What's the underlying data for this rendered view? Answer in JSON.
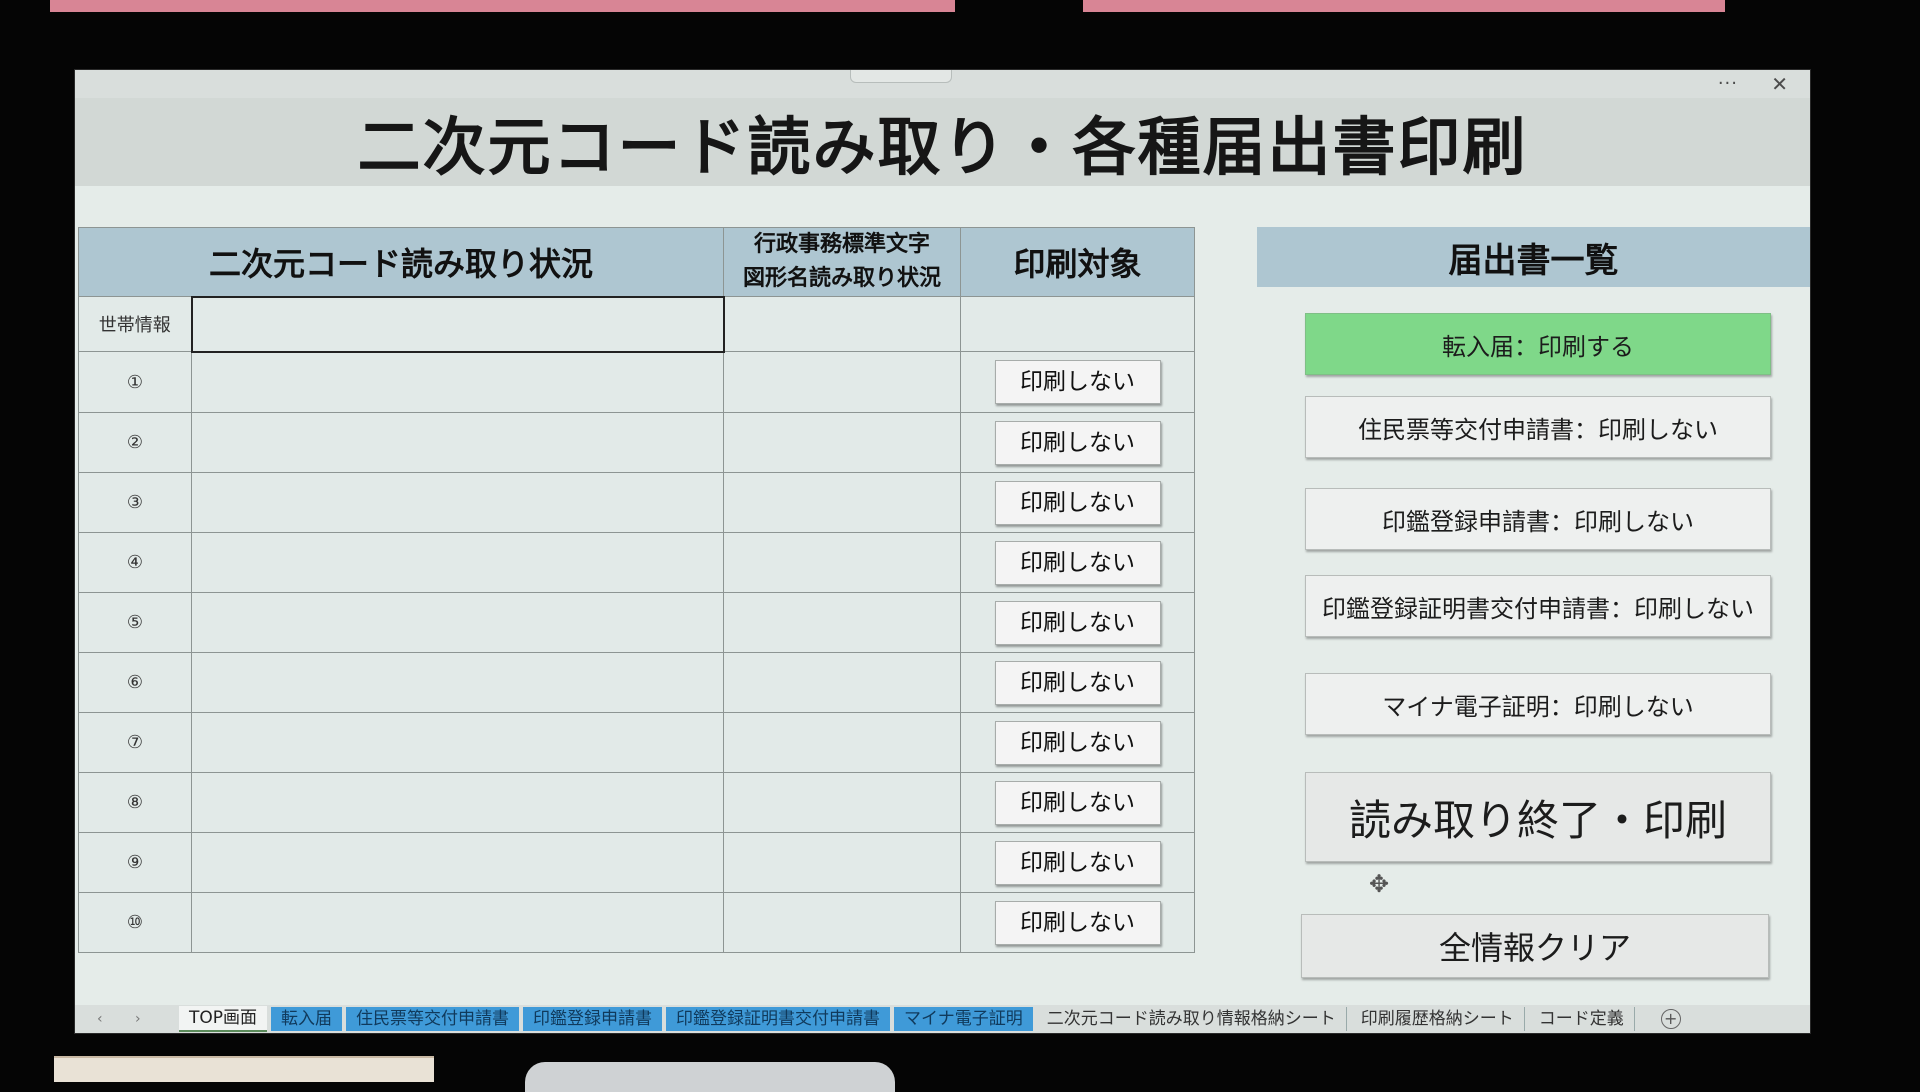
{
  "window": {
    "more_label": "···",
    "close_label": "✕"
  },
  "title": "二次元コード読み取り・各種届出書印刷",
  "table": {
    "headers": {
      "scan_status": "二次元コード読み取り状況",
      "std_char_line1": "行政事務標準文字",
      "std_char_line2": "図形名読み取り状況",
      "print_target": "印刷対象"
    },
    "household_label": "世帯情報",
    "rows": [
      {
        "label": "①",
        "button": "印刷しない"
      },
      {
        "label": "②",
        "button": "印刷しない"
      },
      {
        "label": "③",
        "button": "印刷しない"
      },
      {
        "label": "④",
        "button": "印刷しない"
      },
      {
        "label": "⑤",
        "button": "印刷しない"
      },
      {
        "label": "⑥",
        "button": "印刷しない"
      },
      {
        "label": "⑦",
        "button": "印刷しない"
      },
      {
        "label": "⑧",
        "button": "印刷しない"
      },
      {
        "label": "⑨",
        "button": "印刷しない"
      },
      {
        "label": "⑩",
        "button": "印刷しない"
      }
    ]
  },
  "forms_panel": {
    "header": "届出書一覧",
    "buttons": {
      "tennyu": "転入届：印刷する",
      "juminhyo": "住民票等交付申請書：印刷しない",
      "inkan": "印鑑登録申請書：印刷しない",
      "inkan_cert": "印鑑登録証明書交付申請書：印刷しない",
      "myna": "マイナ電子証明：印刷しない",
      "finish": "読み取り終了・印刷",
      "clear": "全情報クリア"
    },
    "active_color": "#7fd889"
  },
  "sheet_tabs": [
    "TOP画面",
    "転入届",
    "住民票等交付申請書",
    "印鑑登録申請書",
    "印鑑登録証明書交付申請書",
    "マイナ電子証明",
    "二次元コード読み取り情報格納シート",
    "印刷履歴格納シート",
    "コード定義"
  ],
  "sheet_nav": "‹ ›",
  "add_sheet": "+",
  "cursor_glyph": "✥"
}
